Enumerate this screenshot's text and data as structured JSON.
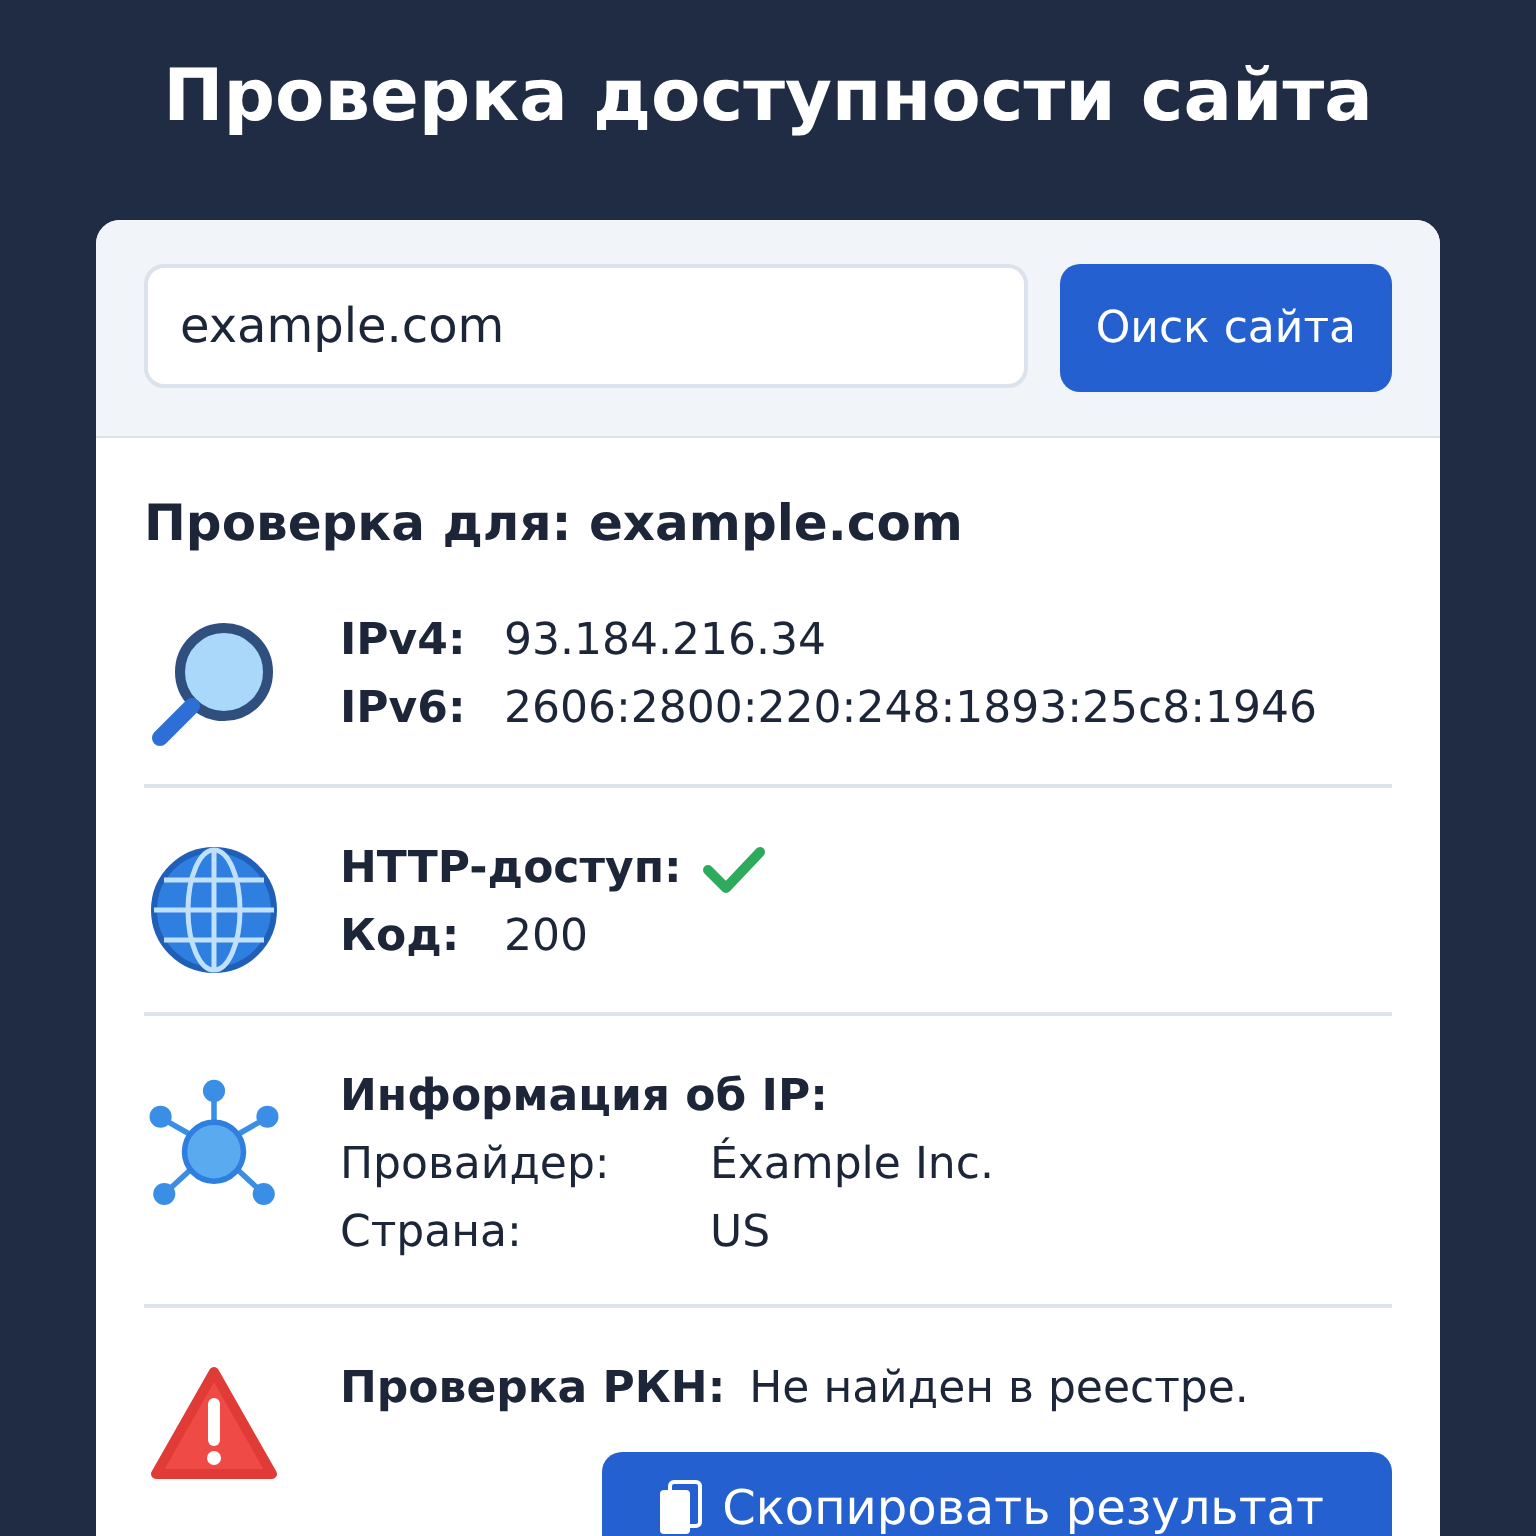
{
  "title": "Проверка доступности сайта",
  "search": {
    "value": "example.com",
    "button": "Оиск сайта"
  },
  "heading": "Проверка для: example.com",
  "sections": [
    {
      "kind": "pairs",
      "rows": [
        {
          "label": "IPv4:",
          "value": "93.184.216.34"
        },
        {
          "label": "IPv6:",
          "value": "2606:2800:220:248:1893:25c8:1946"
        }
      ]
    },
    {
      "kind": "pairs",
      "rows": [
        {
          "label": "HTTP-доступ:",
          "ok": true
        },
        {
          "label": "Код:",
          "value": "200"
        }
      ]
    },
    {
      "kind": "info",
      "heading": "Информация об IP:",
      "rows": [
        {
          "label": "Провайдер:",
          "value": "Éxample Inc."
        },
        {
          "label": "Страна:",
          "value": "US"
        }
      ]
    },
    {
      "kind": "inline",
      "rows": [
        {
          "label": "Проверка РКН:",
          "value": "Не найден в реестре."
        }
      ],
      "action": "Скопировать результат"
    }
  ]
}
